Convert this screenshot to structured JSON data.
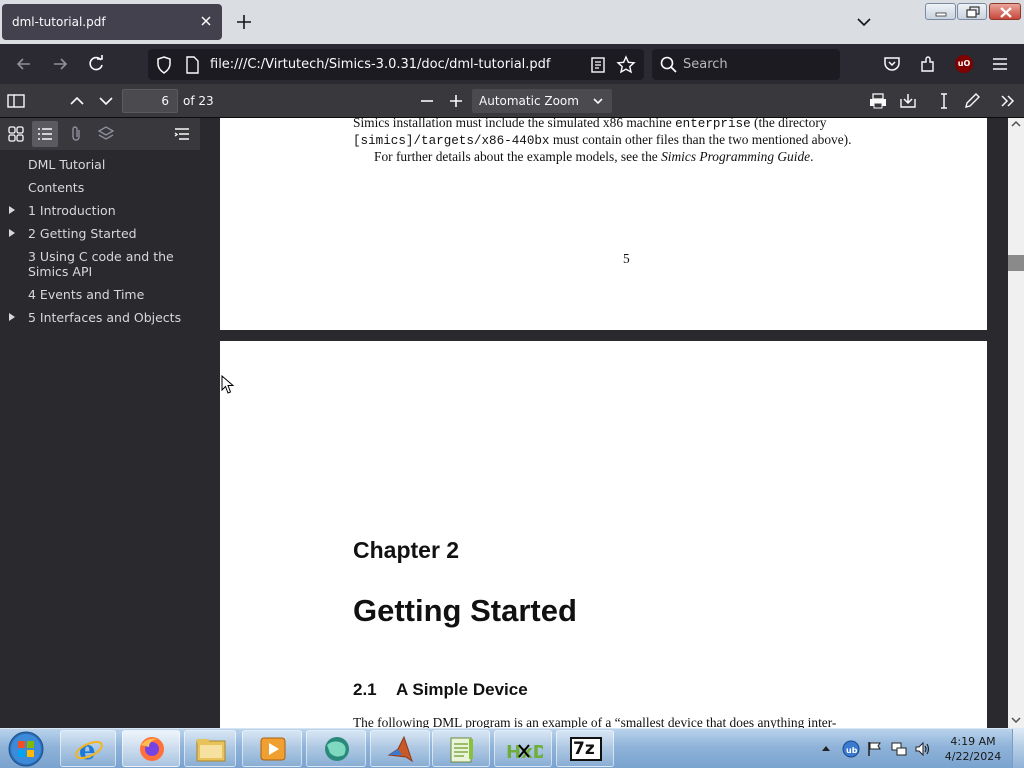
{
  "browser": {
    "tab_title": "dml-tutorial.pdf",
    "url": "file:///C:/Virtutech/Simics-3.0.31/doc/dml-tutorial.pdf",
    "search_placeholder": "Search",
    "ublock_badge": "uO"
  },
  "pdf_toolbar": {
    "page_number": "6",
    "page_count": "of 23",
    "zoom": "Automatic Zoom"
  },
  "outline": [
    {
      "label": "DML Tutorial",
      "expandable": false
    },
    {
      "label": "Contents",
      "expandable": false
    },
    {
      "label": "1 Introduction",
      "expandable": true
    },
    {
      "label": "2 Getting Started",
      "expandable": true
    },
    {
      "label": "3 Using C code and the Simics API",
      "expandable": false
    },
    {
      "label": "4 Events and Time",
      "expandable": false
    },
    {
      "label": "5 Interfaces and Objects",
      "expandable": true
    }
  ],
  "page5": {
    "line1_a": "Simics installation must include the simulated x86 machine ",
    "line1_code": "enterprise",
    "line1_b": " (the directory",
    "line2_code": "[simics]/targets/x86-440bx",
    "line2_b": " must contain other files than the two mentioned above).",
    "line3_a": "For further details about the example models, see the ",
    "line3_italic": "Simics Programming Guide",
    "line3_b": ".",
    "page_number": "5"
  },
  "page6": {
    "chapter_label": "Chapter 2",
    "chapter_title": "Getting Started",
    "section_number": "2.1",
    "section_title": "A Simple Device",
    "body_line": "The following DML program is an example of a “smallest device that does anything inter-"
  },
  "taskbar": {
    "time": "4:19 AM",
    "date": "4/22/2024",
    "apps": [
      "internet-explorer",
      "firefox",
      "file-explorer",
      "media-player",
      "app-globe",
      "matlab",
      "notepad-plus-plus",
      "hxd-hex-editor",
      "7-zip"
    ],
    "app_7zip_label": "7z",
    "app_hxd_label": "HxD"
  }
}
